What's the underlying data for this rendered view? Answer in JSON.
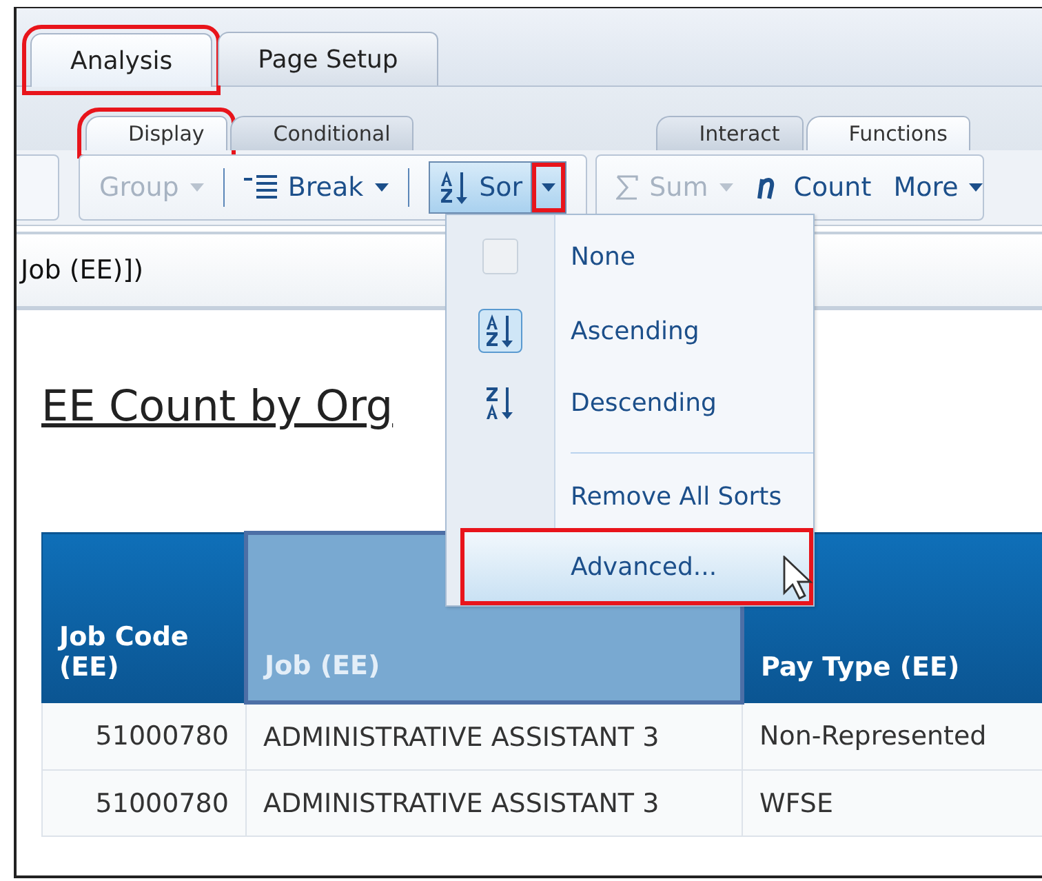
{
  "top_tabs": [
    {
      "label": "Analysis",
      "selected": true,
      "highlighted": true
    },
    {
      "label": "Page Setup",
      "selected": false,
      "highlighted": false
    }
  ],
  "sub_tabs_left": [
    {
      "label": "Display",
      "selected": true,
      "highlighted": true
    },
    {
      "label": "Conditional",
      "selected": false,
      "highlighted": false
    }
  ],
  "sub_tabs_right": [
    {
      "label": "Interact",
      "selected": false,
      "highlighted": false
    },
    {
      "label": "Functions",
      "selected": true,
      "highlighted": false
    }
  ],
  "toolbar_left": [
    {
      "kind": "dropdown",
      "label": "Group",
      "disabled": true
    },
    {
      "kind": "break",
      "label": "Break",
      "disabled": false
    },
    {
      "kind": "sort",
      "label": "Sor",
      "open": true,
      "highlighted": true
    }
  ],
  "toolbar_right": [
    {
      "kind": "sum",
      "label": "Sum",
      "disabled": true
    },
    {
      "kind": "count",
      "label": "Count",
      "disabled": false
    },
    {
      "kind": "more",
      "label": "More",
      "disabled": false
    }
  ],
  "formula": "Job (EE)])",
  "report_title": "EE Count by Org",
  "sort_menu": [
    {
      "kind": "none",
      "label": "None",
      "selected": false,
      "highlighted": false
    },
    {
      "kind": "ascending",
      "label": "Ascending",
      "selected": true,
      "highlighted": false
    },
    {
      "kind": "descending",
      "label": "Descending",
      "selected": false,
      "highlighted": false
    },
    {
      "kind": "separator"
    },
    {
      "kind": "plain",
      "label": "Remove All Sorts",
      "highlighted": false
    },
    {
      "kind": "plain",
      "label": "Advanced...",
      "highlighted": true
    }
  ],
  "table": {
    "columns": [
      {
        "label": "Job Code (EE)",
        "selected": false
      },
      {
        "label": "Job (EE)",
        "selected": true
      },
      {
        "label": "Pay Type (EE)",
        "selected": false
      }
    ],
    "rows": [
      [
        "51000780",
        "ADMINISTRATIVE ASSISTANT 3",
        "Non-Represented"
      ],
      [
        "51000780",
        "ADMINISTRATIVE ASSISTANT 3",
        "WFSE"
      ]
    ]
  }
}
